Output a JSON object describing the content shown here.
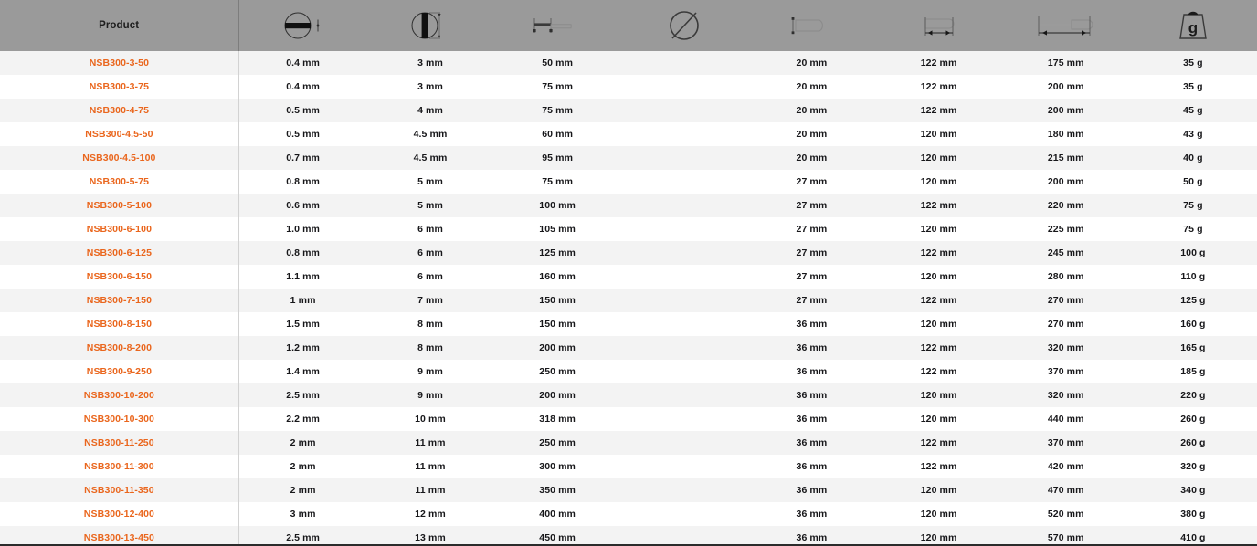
{
  "table": {
    "accent_color": "#ea661d",
    "header_bg": "#9a9a9a",
    "stripe_bg": "#f3f3f3",
    "columns": [
      {
        "key": "product",
        "label": "Product",
        "icon": null
      },
      {
        "key": "blade_thick",
        "label": "",
        "icon": "slot-thickness-icon"
      },
      {
        "key": "blade_width",
        "label": "",
        "icon": "slot-width-icon"
      },
      {
        "key": "blade_length",
        "label": "",
        "icon": "blade-length-icon"
      },
      {
        "key": "shaft_dia",
        "label": "",
        "icon": "diameter-icon"
      },
      {
        "key": "handle_dia",
        "label": "",
        "icon": "handle-diameter-icon"
      },
      {
        "key": "handle_len",
        "label": "",
        "icon": "handle-length-icon"
      },
      {
        "key": "total_len",
        "label": "",
        "icon": "total-length-icon"
      },
      {
        "key": "weight",
        "label": "g",
        "icon": "weight-icon"
      }
    ],
    "rows": [
      {
        "product": "NSB300-3-50",
        "blade_thick": "0.4 mm",
        "blade_width": "3 mm",
        "blade_length": "50 mm",
        "handle_dia": "20 mm",
        "handle_len": "122 mm",
        "total_len": "175 mm",
        "weight": "35 g"
      },
      {
        "product": "NSB300-3-75",
        "blade_thick": "0.4 mm",
        "blade_width": "3 mm",
        "blade_length": "75 mm",
        "handle_dia": "20 mm",
        "handle_len": "122 mm",
        "total_len": "200 mm",
        "weight": "35 g"
      },
      {
        "product": "NSB300-4-75",
        "blade_thick": "0.5 mm",
        "blade_width": "4 mm",
        "blade_length": "75 mm",
        "handle_dia": "20 mm",
        "handle_len": "122 mm",
        "total_len": "200 mm",
        "weight": "45 g"
      },
      {
        "product": "NSB300-4.5-50",
        "blade_thick": "0.5 mm",
        "blade_width": "4.5 mm",
        "blade_length": "60 mm",
        "handle_dia": "20 mm",
        "handle_len": "120 mm",
        "total_len": "180 mm",
        "weight": "43 g"
      },
      {
        "product": "NSB300-4.5-100",
        "blade_thick": "0.7 mm",
        "blade_width": "4.5 mm",
        "blade_length": "95 mm",
        "handle_dia": "20 mm",
        "handle_len": "120 mm",
        "total_len": "215 mm",
        "weight": "40 g"
      },
      {
        "product": "NSB300-5-75",
        "blade_thick": "0.8 mm",
        "blade_width": "5 mm",
        "blade_length": "75 mm",
        "handle_dia": "27 mm",
        "handle_len": "120 mm",
        "total_len": "200 mm",
        "weight": "50 g"
      },
      {
        "product": "NSB300-5-100",
        "blade_thick": "0.6 mm",
        "blade_width": "5 mm",
        "blade_length": "100 mm",
        "handle_dia": "27 mm",
        "handle_len": "122 mm",
        "total_len": "220 mm",
        "weight": "75 g"
      },
      {
        "product": "NSB300-6-100",
        "blade_thick": "1.0 mm",
        "blade_width": "6 mm",
        "blade_length": "105 mm",
        "handle_dia": "27 mm",
        "handle_len": "120 mm",
        "total_len": "225 mm",
        "weight": "75 g"
      },
      {
        "product": "NSB300-6-125",
        "blade_thick": "0.8 mm",
        "blade_width": "6 mm",
        "blade_length": "125 mm",
        "handle_dia": "27 mm",
        "handle_len": "122 mm",
        "total_len": "245 mm",
        "weight": "100 g"
      },
      {
        "product": "NSB300-6-150",
        "blade_thick": "1.1 mm",
        "blade_width": "6 mm",
        "blade_length": "160 mm",
        "handle_dia": "27 mm",
        "handle_len": "120 mm",
        "total_len": "280 mm",
        "weight": "110 g"
      },
      {
        "product": "NSB300-7-150",
        "blade_thick": "1 mm",
        "blade_width": "7 mm",
        "blade_length": "150 mm",
        "handle_dia": "27 mm",
        "handle_len": "122 mm",
        "total_len": "270 mm",
        "weight": "125 g"
      },
      {
        "product": "NSB300-8-150",
        "blade_thick": "1.5 mm",
        "blade_width": "8 mm",
        "blade_length": "150 mm",
        "handle_dia": "36 mm",
        "handle_len": "120 mm",
        "total_len": "270 mm",
        "weight": "160 g"
      },
      {
        "product": "NSB300-8-200",
        "blade_thick": "1.2 mm",
        "blade_width": "8 mm",
        "blade_length": "200 mm",
        "handle_dia": "36 mm",
        "handle_len": "122 mm",
        "total_len": "320 mm",
        "weight": "165 g"
      },
      {
        "product": "NSB300-9-250",
        "blade_thick": "1.4 mm",
        "blade_width": "9 mm",
        "blade_length": "250 mm",
        "handle_dia": "36 mm",
        "handle_len": "122 mm",
        "total_len": "370 mm",
        "weight": "185 g"
      },
      {
        "product": "NSB300-10-200",
        "blade_thick": "2.5 mm",
        "blade_width": "9 mm",
        "blade_length": "200 mm",
        "handle_dia": "36 mm",
        "handle_len": "120 mm",
        "total_len": "320 mm",
        "weight": "220 g"
      },
      {
        "product": "NSB300-10-300",
        "blade_thick": "2.2 mm",
        "blade_width": "10 mm",
        "blade_length": "318 mm",
        "handle_dia": "36 mm",
        "handle_len": "120 mm",
        "total_len": "440 mm",
        "weight": "260 g"
      },
      {
        "product": "NSB300-11-250",
        "blade_thick": "2 mm",
        "blade_width": "11 mm",
        "blade_length": "250 mm",
        "handle_dia": "36 mm",
        "handle_len": "122 mm",
        "total_len": "370 mm",
        "weight": "260 g"
      },
      {
        "product": "NSB300-11-300",
        "blade_thick": "2 mm",
        "blade_width": "11 mm",
        "blade_length": "300 mm",
        "handle_dia": "36 mm",
        "handle_len": "122 mm",
        "total_len": "420 mm",
        "weight": "320 g"
      },
      {
        "product": "NSB300-11-350",
        "blade_thick": "2 mm",
        "blade_width": "11 mm",
        "blade_length": "350 mm",
        "handle_dia": "36 mm",
        "handle_len": "120 mm",
        "total_len": "470 mm",
        "weight": "340 g"
      },
      {
        "product": "NSB300-12-400",
        "blade_thick": "3 mm",
        "blade_width": "12 mm",
        "blade_length": "400 mm",
        "handle_dia": "36 mm",
        "handle_len": "120 mm",
        "total_len": "520 mm",
        "weight": "380 g"
      },
      {
        "product": "NSB300-13-450",
        "blade_thick": "2.5 mm",
        "blade_width": "13 mm",
        "blade_length": "450 mm",
        "handle_dia": "36 mm",
        "handle_len": "120 mm",
        "total_len": "570 mm",
        "weight": "410 g"
      }
    ]
  }
}
